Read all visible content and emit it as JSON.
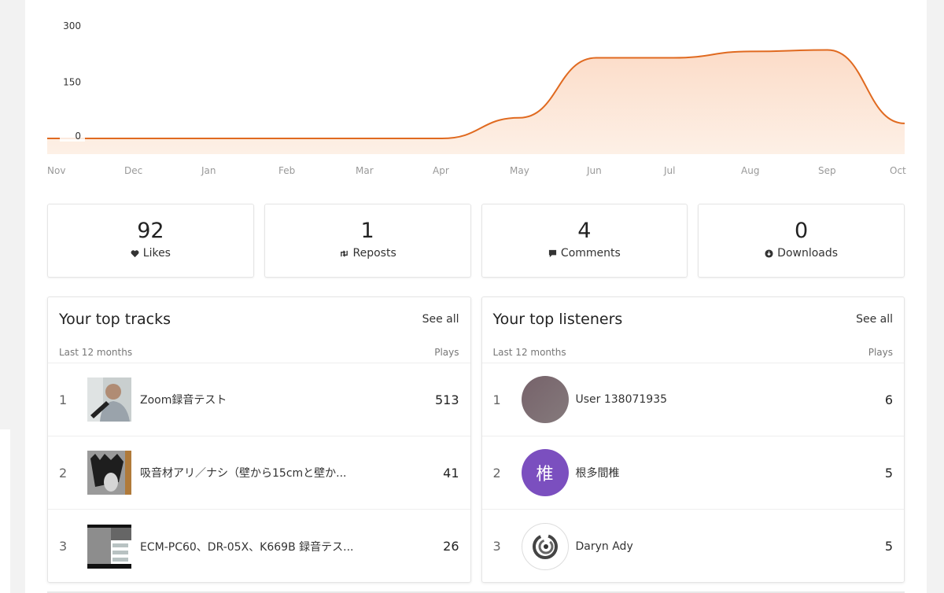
{
  "chart_data": {
    "type": "area",
    "title": "",
    "xlabel": "",
    "ylabel": "",
    "categories": [
      "Nov",
      "Dec",
      "Jan",
      "Feb",
      "Mar",
      "Apr",
      "May",
      "Jun",
      "Jul",
      "Aug",
      "Sep",
      "Oct"
    ],
    "series": [
      {
        "name": "Plays",
        "values": [
          0,
          0,
          0,
          0,
          0,
          0,
          55,
          215,
          215,
          232,
          236,
          40
        ]
      }
    ],
    "yticks": [
      0,
      150,
      300
    ],
    "ylim": [
      0,
      340
    ],
    "grid": false,
    "legend": "none",
    "colors": {
      "line": "#e06a20",
      "fill_top": "#fcdcc8",
      "fill_bottom": "#fdf0e6"
    }
  },
  "stats": [
    {
      "value": "92",
      "label": "Likes",
      "icon": "heart-icon"
    },
    {
      "value": "1",
      "label": "Reposts",
      "icon": "repost-icon"
    },
    {
      "value": "4",
      "label": "Comments",
      "icon": "comment-icon"
    },
    {
      "value": "0",
      "label": "Downloads",
      "icon": "download-icon"
    }
  ],
  "top_tracks": {
    "title": "Your top tracks",
    "see_all": "See all",
    "period": "Last 12 months",
    "column": "Plays",
    "rows": [
      {
        "rank": "1",
        "name": "Zoom録音テスト",
        "plays": "513"
      },
      {
        "rank": "2",
        "name": "吸音材アリ／ナシ（壁から15cmと壁か...",
        "plays": "41"
      },
      {
        "rank": "3",
        "name": "ECM-PC60、DR-05X、K669B 録音テス...",
        "plays": "26"
      }
    ]
  },
  "top_listeners": {
    "title": "Your top listeners",
    "see_all": "See all",
    "period": "Last 12 months",
    "column": "Plays",
    "rows": [
      {
        "rank": "1",
        "name": "User 138071935",
        "plays": "6",
        "avatar_color": "#7d6a70"
      },
      {
        "rank": "2",
        "name": "根多間椎",
        "plays": "5",
        "avatar_color": "#7b4fbf",
        "avatar_letter": "椎"
      },
      {
        "rank": "3",
        "name": "Daryn Ady",
        "plays": "5"
      }
    ]
  }
}
